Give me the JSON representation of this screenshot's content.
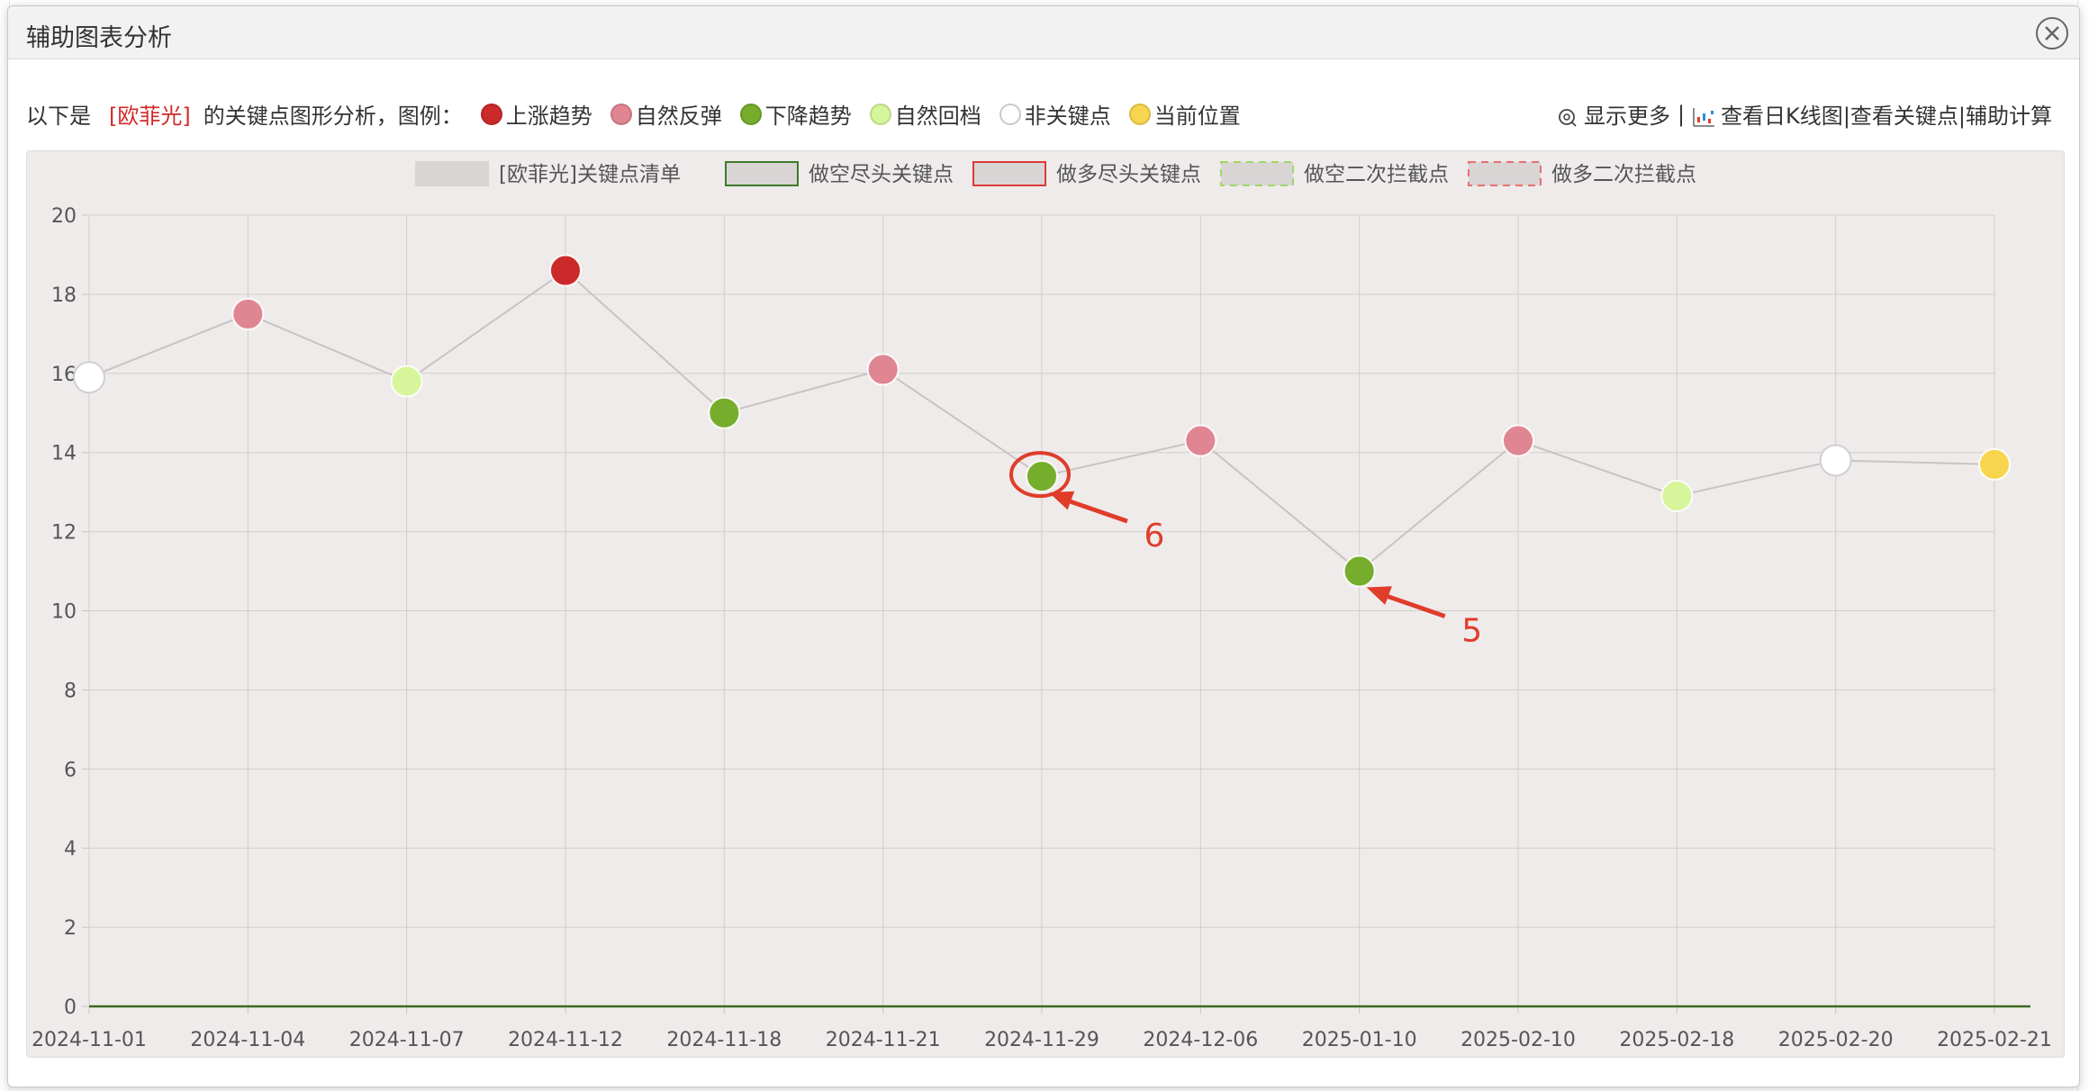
{
  "dialog": {
    "title": "辅助图表分析"
  },
  "info": {
    "prefix": "以下是",
    "stock": "[欧菲光]",
    "suffix": "的关键点图形分析，图例：",
    "legend": [
      {
        "label": "上涨趋势",
        "color": "#cc2a2a",
        "icon": "dark-red-dot-icon"
      },
      {
        "label": "自然反弹",
        "color": "#e08592",
        "icon": "pink-dot-icon"
      },
      {
        "label": "下降趋势",
        "color": "#76ad2c",
        "icon": "green-dot-icon"
      },
      {
        "label": "自然回档",
        "color": "#d7f59a",
        "icon": "light-green-dot-icon"
      },
      {
        "label": "非关键点",
        "color": "#ffffff",
        "icon": "white-dot-icon"
      },
      {
        "label": "当前位置",
        "color": "#f8d54e",
        "icon": "yellow-dot-icon"
      }
    ],
    "links": {
      "show_more": "显示更多",
      "sep": "|",
      "view_k": "查看日K线图",
      "view_keypoints": "|查看关键点",
      "aux_calc": "|辅助计算"
    }
  },
  "chart_data": {
    "type": "line",
    "legend": [
      {
        "label": "[欧菲光]关键点清单",
        "fill": "#d9d5d5",
        "stroke": "#d9d5d5",
        "dash": "none"
      },
      {
        "label": "做空尽头关键点",
        "fill": "#d9d5d5",
        "stroke": "#3d7a2a",
        "dash": "none"
      },
      {
        "label": "做多尽头关键点",
        "fill": "#d9d5d5",
        "stroke": "#d93a3a",
        "dash": "none"
      },
      {
        "label": "做空二次拦截点",
        "fill": "#d9d5d5",
        "stroke": "#9fd86a",
        "dash": "dashed"
      },
      {
        "label": "做多二次拦截点",
        "fill": "#d9d5d5",
        "stroke": "#e87070",
        "dash": "dashed"
      }
    ],
    "categories": [
      "2024-11-01",
      "2024-11-04",
      "2024-11-07",
      "2024-11-12",
      "2024-11-18",
      "2024-11-21",
      "2024-11-29",
      "2024-12-06",
      "2025-01-10",
      "2025-02-10",
      "2025-02-18",
      "2025-02-20",
      "2025-02-21"
    ],
    "values": [
      15.9,
      17.5,
      15.8,
      18.6,
      15.0,
      16.1,
      13.4,
      14.3,
      11.0,
      14.3,
      12.9,
      13.8,
      13.7
    ],
    "point_colors": [
      "#ffffff",
      "#e08592",
      "#d7f59a",
      "#cc2a2a",
      "#76ad2c",
      "#e08592",
      "#76ad2c",
      "#e08592",
      "#76ad2c",
      "#e08592",
      "#d7f59a",
      "#ffffff",
      "#f8d54e"
    ],
    "baseline_value": 0,
    "ylim": [
      0,
      20
    ],
    "yticks": [
      0,
      2,
      4,
      6,
      8,
      10,
      12,
      14,
      16,
      18,
      20
    ],
    "grid": true,
    "annotations": [
      {
        "label": "6",
        "target_index": 6,
        "circled": true,
        "color": "#e03c2a"
      },
      {
        "label": "5",
        "target_index": 8,
        "circled": false,
        "color": "#e03c2a"
      }
    ]
  }
}
